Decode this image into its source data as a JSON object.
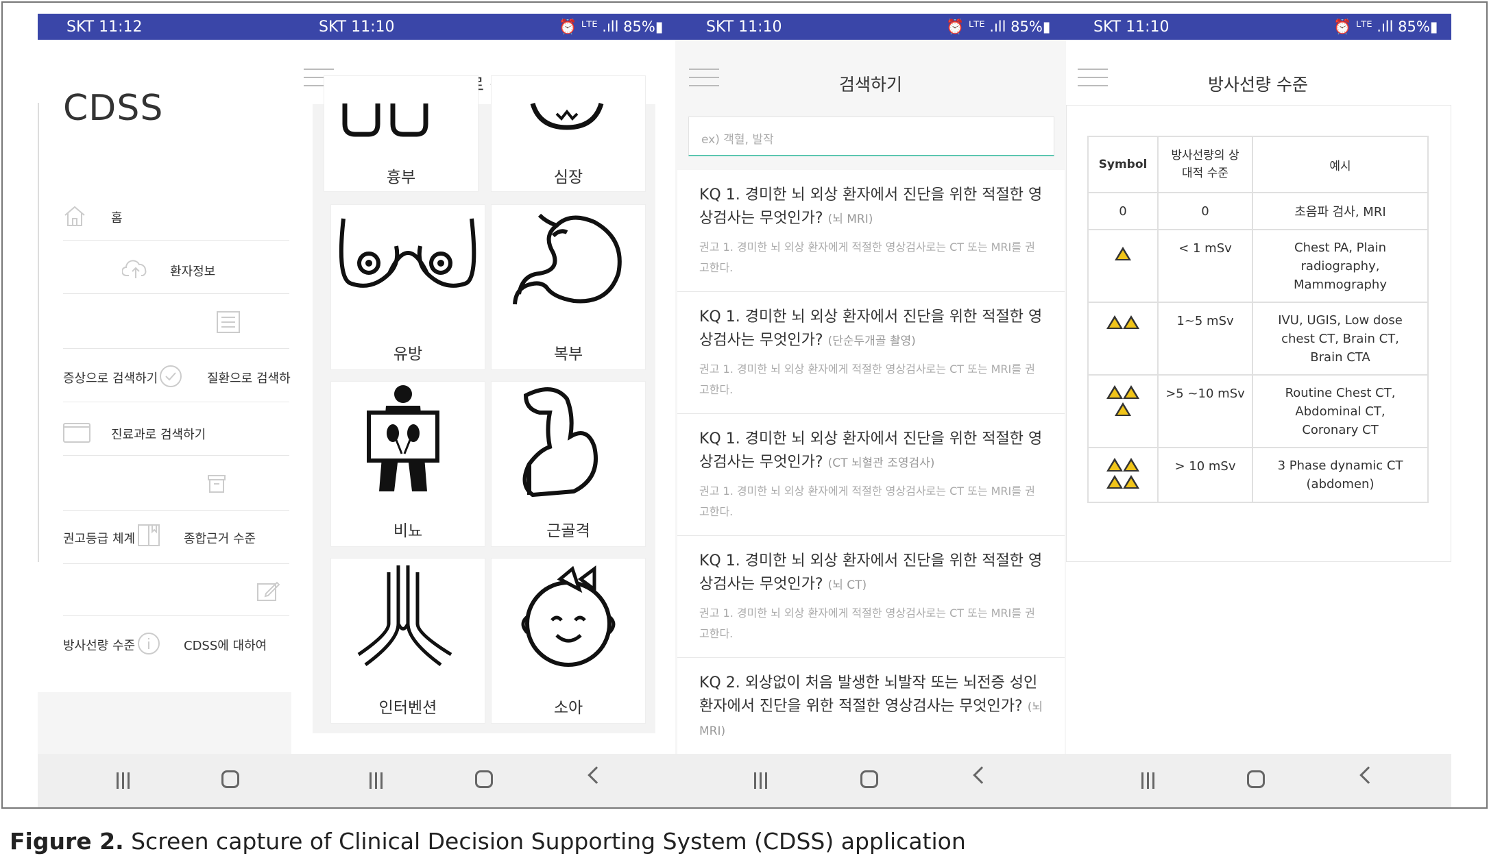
{
  "status_bar": {
    "screens": [
      {
        "carrier_time": "SKT 11:12",
        "right": ""
      },
      {
        "carrier_time": "SKT 11:10",
        "right": "⏰ ᴸᵀᴱ .ıll 85%▮"
      },
      {
        "carrier_time": "SKT 11:10",
        "right": "⏰ ᴸᵀᴱ .ıll 85%▮"
      },
      {
        "carrier_time": "SKT 11:10",
        "right": "⏰ ᴸᵀᴱ .ıll 85%▮"
      }
    ]
  },
  "screen1": {
    "app_title": "CDSS",
    "menu": {
      "home": "홈",
      "patient_info": "환자정보",
      "search_symptom": "증상으로 검색하기",
      "search_disease": "질환으로 검색하",
      "search_department": "진료과로 검색하기",
      "recommendation_grade": "권고등급 체계",
      "evidence_level": "종합근거 수준",
      "radiation_level": "방사선량 수준",
      "about": "CDSS에 대하여"
    }
  },
  "screen2": {
    "title": "진료과로 검색하기",
    "tiles": [
      "흉부",
      "심장",
      "유방",
      "복부",
      "비뇨",
      "근골격",
      "인터벤션",
      "소아"
    ]
  },
  "screen3": {
    "title": "검색하기",
    "search_placeholder": "ex) 객혈, 발작",
    "items": [
      {
        "title": "KQ 1. 경미한 뇌 외상 환자에서 진단을 위한 적절한 영상검사는 무엇인가?",
        "tag": "(뇌 MRI)",
        "rec": "권고 1. 경미한 뇌 외상 환자에게 적절한 영상검사로는 CT 또는 MRI를 권고한다."
      },
      {
        "title": "KQ 1. 경미한 뇌 외상 환자에서 진단을 위한 적절한 영상검사는 무엇인가?",
        "tag": "(단순두개골 촬영)",
        "rec": "권고 1. 경미한 뇌 외상 환자에게 적절한 영상검사로는 CT 또는 MRI를 권고한다."
      },
      {
        "title": "KQ 1. 경미한 뇌 외상 환자에서 진단을 위한 적절한 영상검사는 무엇인가?",
        "tag": "(CT 뇌혈관 조영검사)",
        "rec": "권고 1. 경미한 뇌 외상 환자에게 적절한 영상검사로는 CT 또는 MRI를 권고한다."
      },
      {
        "title": "KQ 1. 경미한 뇌 외상 환자에서 진단을 위한 적절한 영상검사는 무엇인가?",
        "tag": "(뇌 CT)",
        "rec": "권고 1. 경미한 뇌 외상 환자에게 적절한 영상검사로는 CT 또는 MRI를 권고한다."
      },
      {
        "title": "KQ 2. 외상없이 처음 발생한 뇌발작 또는 뇌전증 성인환자에서 진단을 위한 적절한 영상검사는 무엇인가?",
        "tag": "(뇌 MRI)",
        "rec": ""
      }
    ]
  },
  "screen4": {
    "title": "방사선량 수준",
    "headers": [
      "Symbol",
      "방사선량의 상대적 수준",
      "예시"
    ],
    "rows": [
      {
        "symbol": "0",
        "level": "0",
        "example": "초음파 검사, MRI"
      },
      {
        "symbol": "",
        "level": "< 1 mSv",
        "example": "Chest PA, Plain radiography, Mammography"
      },
      {
        "symbol": "",
        "level": "1~5 mSv",
        "example": "IVU, UGIS, Low dose chest CT, Brain CT, Brain CTA"
      },
      {
        "symbol": "",
        "level": ">5 ~10 mSv",
        "example": "Routine Chest CT, Abdominal CT, Coronary CT"
      },
      {
        "symbol": "",
        "level": "> 10 mSv",
        "example": "3 Phase dynamic CT (abdomen)"
      }
    ],
    "hazard_color": "#f0c419"
  },
  "caption": {
    "label": "Figure 2.",
    "text": " Screen capture of Clinical Decision Supporting System (CDSS) application"
  }
}
